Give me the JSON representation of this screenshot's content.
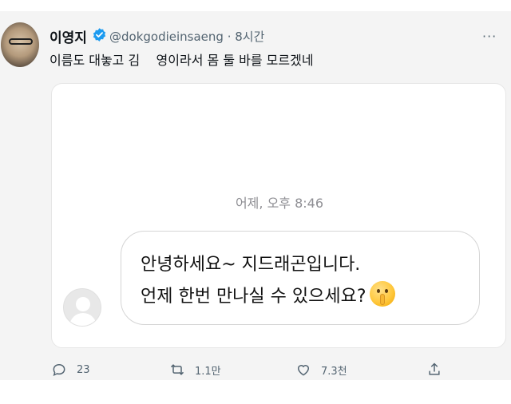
{
  "tweet": {
    "author_name": "이영지",
    "handle_and_time": "@dokgodieinsaeng · 8시간",
    "more_icon": "more-icon",
    "text": "이름도 대놓고 김    영이라서 몸 둘 바를 모르겠네"
  },
  "card": {
    "timestamp": "어제, 오후 8:46",
    "message_line1": "안녕하세요~ 지드래곤입니다.",
    "message_line2": "언제 한번 만나실 수 있으세요?",
    "emoji": "shushing-face-emoji"
  },
  "actions": {
    "reply_count": "23",
    "retweet_count": "1.1만",
    "like_count": "7.3천"
  },
  "colors": {
    "verified": "#1d9bf0",
    "secondary_text": "#536471",
    "background": "#f4f4f4"
  }
}
